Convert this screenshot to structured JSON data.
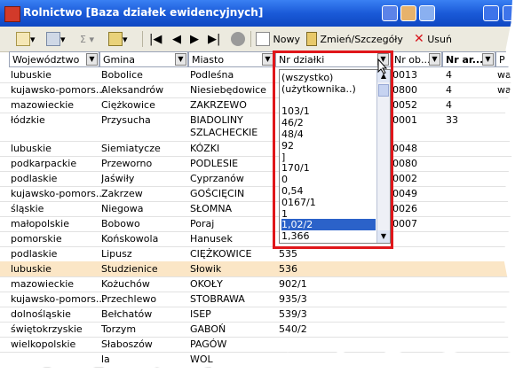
{
  "window": {
    "title": "Rolnictwo [Baza działek ewidencyjnych]"
  },
  "toolbar": {
    "new_label": "Nowy",
    "edit_label": "Zmień/Szczegóły",
    "delete_label": "Usuń"
  },
  "grid": {
    "columns": [
      "Województwo",
      "Gmina",
      "Miasto",
      "Nr działki",
      "Nr ob...",
      "Nr ar...",
      "P"
    ],
    "rows": [
      {
        "woj": "lubuskie",
        "gmina": "Bobolice",
        "miasto": "Podleśna",
        "nr_dz": "",
        "nr_ob": "0013",
        "nr_ar": "4",
        "p": "wa"
      },
      {
        "woj": "kujawsko-pomors...",
        "gmina": "Aleksandrów",
        "miasto": "Niesiebędowice",
        "nr_dz": "",
        "nr_ob": "0800",
        "nr_ar": "4",
        "p": "wa"
      },
      {
        "woj": "mazowieckie",
        "gmina": "Ciężkowice",
        "miasto": "ZAKRZEWO",
        "nr_dz": "",
        "nr_ob": "0052",
        "nr_ar": "4",
        "p": ""
      },
      {
        "woj": "łódzkie",
        "gmina": "Przysucha",
        "miasto": "BIADOLINY SZLACHECKIE",
        "nr_dz": "",
        "nr_ob": "0001",
        "nr_ar": "33",
        "p": ""
      },
      {
        "woj": "lubuskie",
        "gmina": "Siemiatycze",
        "miasto": "KÓZKI",
        "nr_dz": "",
        "nr_ob": "0048",
        "nr_ar": "",
        "p": ""
      },
      {
        "woj": "podkarpackie",
        "gmina": "Przeworno",
        "miasto": "PODLESIE",
        "nr_dz": "",
        "nr_ob": "0080",
        "nr_ar": "",
        "p": ""
      },
      {
        "woj": "podlaskie",
        "gmina": "Jaświły",
        "miasto": "Cyprzanów",
        "nr_dz": "",
        "nr_ob": "0002",
        "nr_ar": "",
        "p": ""
      },
      {
        "woj": "kujawsko-pomors...",
        "gmina": "Zakrzew",
        "miasto": "GOŚCIĘCIN",
        "nr_dz": "",
        "nr_ob": "0049",
        "nr_ar": "",
        "p": ""
      },
      {
        "woj": "śląskie",
        "gmina": "Niegowa",
        "miasto": "SŁOMNA",
        "nr_dz": "",
        "nr_ob": "0026",
        "nr_ar": "",
        "p": ""
      },
      {
        "woj": "małopolskie",
        "gmina": "Bobowo",
        "miasto": "Poraj",
        "nr_dz": "",
        "nr_ob": "0007",
        "nr_ar": "",
        "p": ""
      },
      {
        "woj": "pomorskie",
        "gmina": "Końskowola",
        "miasto": "Hanusek",
        "nr_dz": "",
        "nr_ob": "",
        "nr_ar": "",
        "p": ""
      },
      {
        "woj": "podlaskie",
        "gmina": "Lipusz",
        "miasto": "CIĘŻKOWICE",
        "nr_dz": "535",
        "nr_ob": "",
        "nr_ar": "",
        "p": ""
      },
      {
        "woj": "lubuskie",
        "gmina": "Studzienice",
        "miasto": "Słowik",
        "nr_dz": "536",
        "nr_ob": "",
        "nr_ar": "",
        "p": ""
      },
      {
        "woj": "mazowieckie",
        "gmina": "Kożuchów",
        "miasto": "OKOŁY",
        "nr_dz": "902/1",
        "nr_ob": "",
        "nr_ar": "",
        "p": ""
      },
      {
        "woj": "kujawsko-pomors...",
        "gmina": "Przechlewo",
        "miasto": "STOBRAWA",
        "nr_dz": "935/3",
        "nr_ob": "",
        "nr_ar": "",
        "p": ""
      },
      {
        "woj": "dolnośląskie",
        "gmina": "Bełchatów",
        "miasto": "ISEP",
        "nr_dz": "539/3",
        "nr_ob": "",
        "nr_ar": "",
        "p": ""
      },
      {
        "woj": "świętokrzyskie",
        "gmina": "Torzym",
        "miasto": "GABOŃ",
        "nr_dz": "540/2",
        "nr_ob": "",
        "nr_ar": "",
        "p": ""
      },
      {
        "woj": "wielkopolskie",
        "gmina": "Słaboszów",
        "miasto": "PAGÓW",
        "nr_dz": "",
        "nr_ob": "",
        "nr_ar": "",
        "p": ""
      },
      {
        "woj": "",
        "gmina": "la",
        "miasto": "WOL",
        "nr_dz": "",
        "nr_ob": "",
        "nr_ar": "",
        "p": ""
      }
    ]
  },
  "dropdown": {
    "items": [
      "(wszystko)",
      "(użytkownika..)",
      "",
      "103/1",
      "46/2",
      "48/4",
      "92",
      "]",
      "170/1",
      "0",
      "0,54",
      "0167/1",
      "1",
      "1,02/2",
      "1,366"
    ],
    "selected": "1,02/2"
  },
  "colors": {
    "titlebar": "#1a5ad8",
    "selected_row": "#fbe6c6",
    "dropdown_highlight": "#2b62c9",
    "annotation_border": "#e0161a"
  }
}
